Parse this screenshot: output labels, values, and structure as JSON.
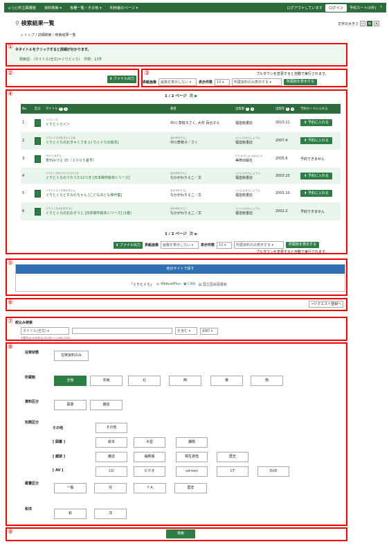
{
  "topbar": {
    "library": "○○市立図書館",
    "nav": [
      "資料検索 ▾",
      "各種一覧・その他 ▾",
      "利用者のページ ▾"
    ],
    "logout": "ログアウトしています",
    "login": "ログイン",
    "cart": "予約カート(0件)",
    "help": "?"
  },
  "page_title": "検索結果一覧",
  "fontsize": {
    "label": "文字の大きさ",
    "small": "小",
    "mid": "中",
    "large": "大"
  },
  "breadcrumb": "トップ / 詳細検索 / 検索結果一覧",
  "section1": {
    "note": "※タイトルをクリックすると詳細が分かります。",
    "query": "検索語：（タイトル(全文)=ぐりとぐら）　件数：13件"
  },
  "section2": {
    "file_btn": "ファイル出力"
  },
  "section3": {
    "note": "プルダウンを変更すると自動で実行されます。",
    "cover_label": "表紙画像",
    "cover_value": "画像を表示しない",
    "count_label": "表示件数",
    "count_value": "10",
    "holdings_value": "所蔵資料のみ表示する",
    "holdings_btn": "所蔵館を表示する"
  },
  "pager": {
    "text": "1 / 2 ページ",
    "next": "次 ▶"
  },
  "table": {
    "headers": [
      "No.",
      "区分",
      "タイトル",
      "著者",
      "出版者",
      "出版年",
      "予約カートに入れる"
    ],
    "rows": [
      {
        "no": "1",
        "ruby": "ぐりとぐら",
        "title": "ぐりとぐら＜＞",
        "author_ruby": "",
        "author": "中川 李枝子さく, 大村 百合子え",
        "pub_ruby": "",
        "pub": "福音館書店",
        "year": "2013.11",
        "action": "予約に入れる"
      },
      {
        "no": "2",
        "ruby": "ぐりとぐらのおきゃくさま",
        "title": "ぐりとぐらのおきゃくさま [ぐりとぐらの絵本]",
        "author_ruby": "なかがわりえこ",
        "author": "中川李枝子／さく",
        "pub_ruby": "ふくいんかんしょてん",
        "pub": "福音館書店",
        "year": "2007.4",
        "action": "予約に入れる"
      },
      {
        "no": "3",
        "ruby": "きせつ みずえ",
        "title": "季刊みづえ 15（２００５夏号）",
        "author_ruby": "",
        "author": "",
        "pub_ruby": "びじゅつしゅっぱんしゃ",
        "pub": "美術出版社",
        "year": "2005.6",
        "action": "予約できません"
      },
      {
        "no": "4",
        "ruby": "ぐりとぐらのうたうた12つき",
        "title": "ぐりとぐらのうたうた12つき [日本傑作絵本シリーズ]",
        "author_ruby": "なかがわりえこ",
        "author": "なかがわりえこ／文",
        "pub_ruby": "ふくいんかんしょてん",
        "pub": "福音館書店",
        "year": "2003.10",
        "action": "予約に入れる"
      },
      {
        "no": "5",
        "ruby": "ぐりとぐらとすみれちゃん",
        "title": "ぐりとぐらとすみれちゃん [こどものとも傑作集]",
        "author_ruby": "なかがわりえこ",
        "author": "なかがわりえこ／文",
        "pub_ruby": "ふくいんかんしょてん",
        "pub": "福音館書店",
        "year": "2003.10",
        "action": "予約に入れる"
      },
      {
        "no": "6",
        "ruby": "ぐりとぐらのおおそうじ",
        "title": "ぐりとぐらのおおそうじ [日本傑作絵本シリーズ] (1巻)",
        "author_ruby": "なかがわりえこ",
        "author": "なかがわりえこ／文",
        "pub_ruby": "ふくいんかんしょてん",
        "pub": "福音館書店",
        "year": "2002.2",
        "action": "予約できません"
      }
    ]
  },
  "section5": {
    "header": "他のサイトで探す",
    "query": "「ぐりとぐら」",
    "links": [
      "WebcatPlus",
      "CiNii",
      "国立国会図書館"
    ]
  },
  "section6": {
    "link": "→リクエスト登録へ"
  },
  "section7": {
    "title": "絞込み検索",
    "field": "タイトル(全文)",
    "contains": "を含む",
    "op": "AND",
    "hint": "出版年≧1998年≦2000年→>1998-2000"
  },
  "section8": {
    "status_label": "在架状態",
    "status_btn": "在架資料のみ",
    "lib_label": "所蔵館",
    "libs": [
      "全館",
      "本館",
      "北",
      "西",
      "東",
      "南"
    ],
    "type_label": "資料区分",
    "types": [
      "図書",
      "雑誌"
    ],
    "form_label": "形態区分",
    "other_label": "その他",
    "other": [
      "その他"
    ],
    "books_label": "[ 図書 ]",
    "books": [
      "絵本",
      "大型",
      "課題"
    ],
    "mag_label": "[ 雑誌 ]",
    "mags": [
      "雑誌",
      "縮刷版",
      "相互貸借",
      "歴史"
    ],
    "av_label": "[ AV ]",
    "av": [
      "CD",
      "ビデオ",
      "cd-rom",
      "CT",
      "DVD"
    ],
    "shelf_label": "蔵書区分",
    "shelf": [
      "一般",
      "児",
      "ＹＡ",
      "歴史"
    ],
    "lang_label": "和洋",
    "langs": [
      "和",
      "洋"
    ]
  },
  "section9": {
    "search_btn": "検索"
  },
  "markers": [
    "①",
    "②",
    "③",
    "④",
    "⑤",
    "⑥",
    "⑦",
    "⑧",
    "⑨"
  ]
}
